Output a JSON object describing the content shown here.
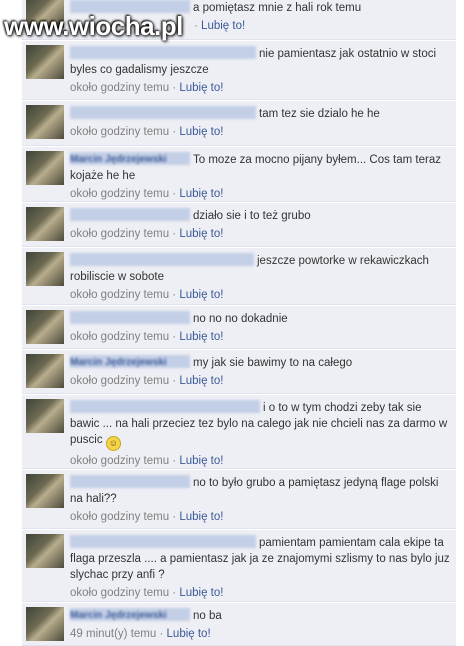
{
  "watermark": "www.wiocha.pl",
  "meta_time": "około godziny temu",
  "meta_sep": "·",
  "like_label": "Lubię to!",
  "last_time": "49 minut(y) temu",
  "comments": [
    {
      "author": "",
      "text": "a pomiętasz mnie z hali rok temu"
    },
    {
      "author": "",
      "text": "nie pamientasz jak ostatnio w stoci byles co gadalismy jeszcze"
    },
    {
      "author": "",
      "text": "tam tez sie dzialo he he"
    },
    {
      "author": "Marcin Jędrzejewski",
      "text": "To moze za mocno pijany byłem... Cos tam teraz kojaże he he"
    },
    {
      "author": "",
      "text": "działo sie i to też grubo"
    },
    {
      "author": "",
      "text": "jeszcze powtorke w rekawiczkach robiliscie w sobote"
    },
    {
      "author": "",
      "text": "no no no dokadnie"
    },
    {
      "author": "Marcin Jędrzejewski",
      "text": "my jak sie bawimy to na całego"
    },
    {
      "author": "",
      "text": "i o to w tym chodzi zeby tak sie bawic ... na hali przeciez tez bylo na calego jak nie chcieli nas za darmo w puscic"
    },
    {
      "author": "",
      "text": "no to było grubo a pamiętasz jedyną flage polski na hali??"
    },
    {
      "author": "",
      "text": "pamientam pamientam cala ekipe ta flaga przeszla .... a pamientasz jak ja ze znajomymi szlismy to nas bylo juz slychac przy anfi ?"
    },
    {
      "author": "Marcin Jędrzejewski",
      "text": "no ba"
    }
  ]
}
